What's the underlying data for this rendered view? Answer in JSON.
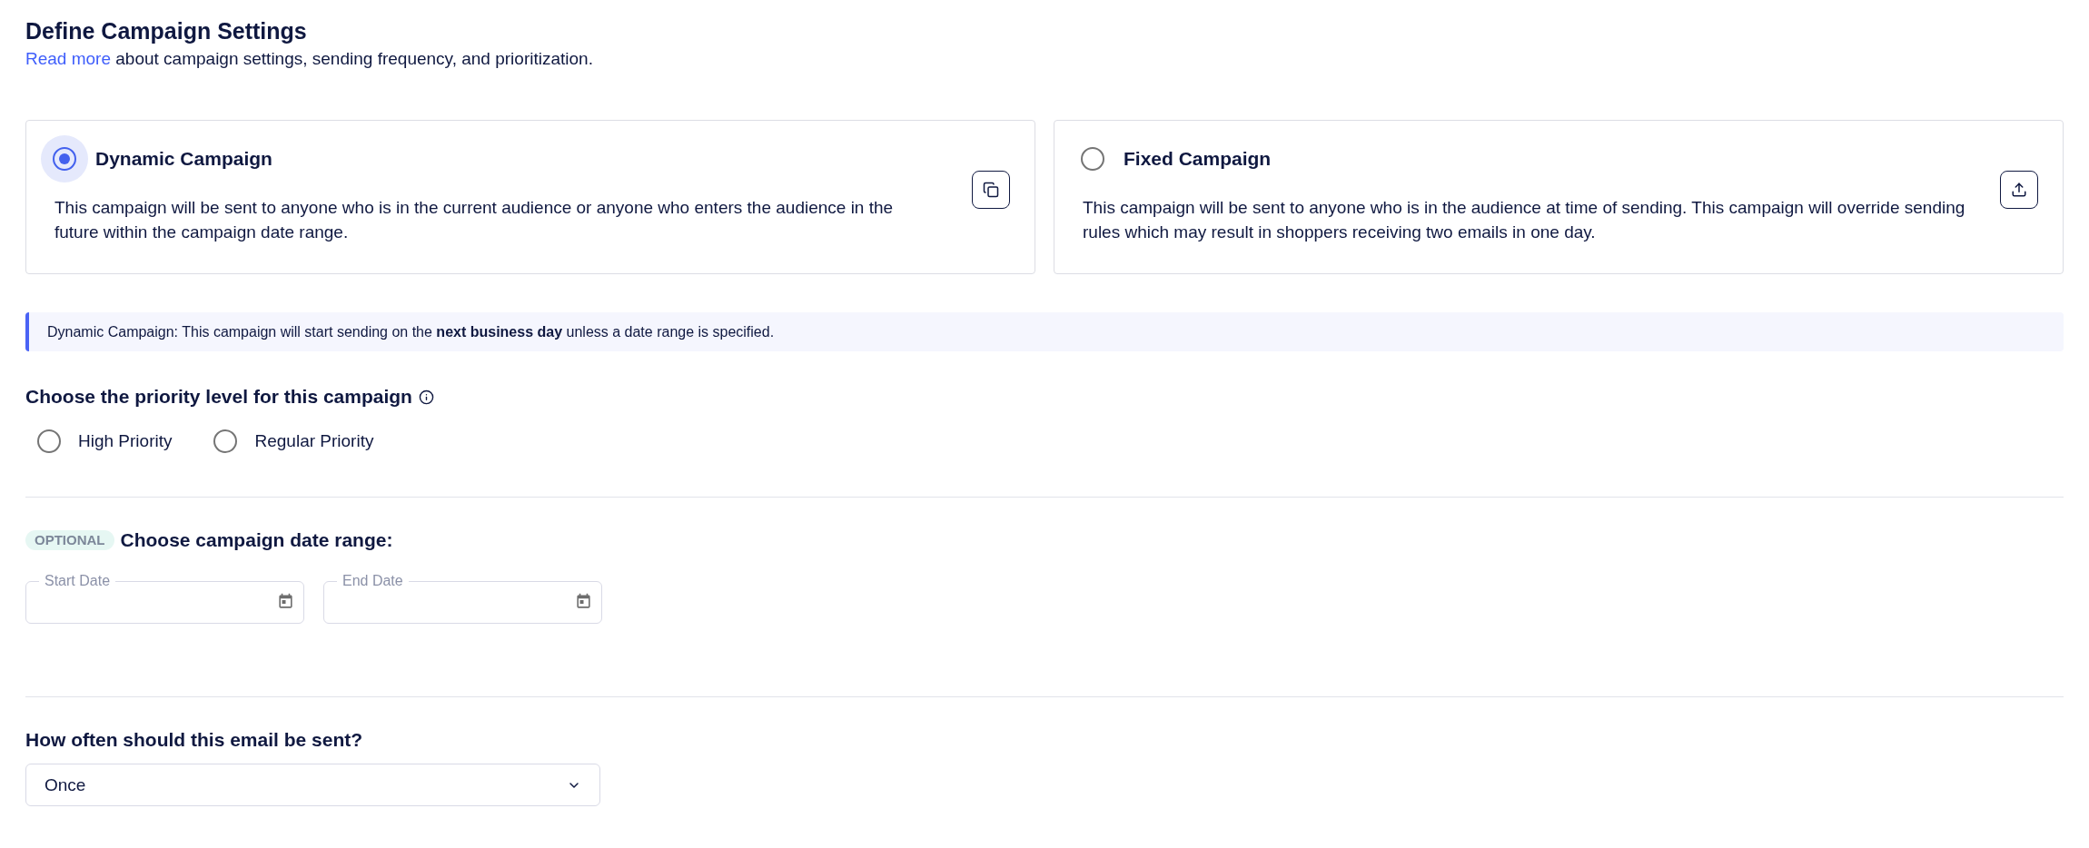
{
  "header": {
    "title": "Define Campaign Settings",
    "link": "Read more",
    "description": "about campaign settings, sending frequency, and prioritization."
  },
  "campaign_types": [
    {
      "kind": "dynamic",
      "label": "Dynamic Campaign",
      "description": "This campaign will be sent to anyone who is in the current audience or anyone who enters the audience in the future within the campaign date range.",
      "selected": true
    },
    {
      "kind": "fixed",
      "label": "Fixed Campaign",
      "description": "This campaign will be sent to anyone who is in the audience at time of sending. This campaign will override sending rules which may result in shoppers receiving two emails in one day.",
      "selected": false
    }
  ],
  "notice": {
    "text": "Dynamic Campaign: This campaign will start sending on the **next business day** unless a date range is specified."
  },
  "priority": {
    "heading": "Choose the priority level for this campaign",
    "options": [
      {
        "label": "High Priority",
        "selected": false
      },
      {
        "label": "Regular Priority",
        "selected": false
      }
    ]
  },
  "date_range": {
    "badge": "OPTIONAL",
    "heading": "Choose campaign date range:",
    "fields": [
      {
        "label": "Start Date"
      },
      {
        "label": "End Date"
      }
    ]
  },
  "frequency": {
    "heading": "How often should this email be sent?",
    "select": {
      "value": "Once"
    }
  }
}
